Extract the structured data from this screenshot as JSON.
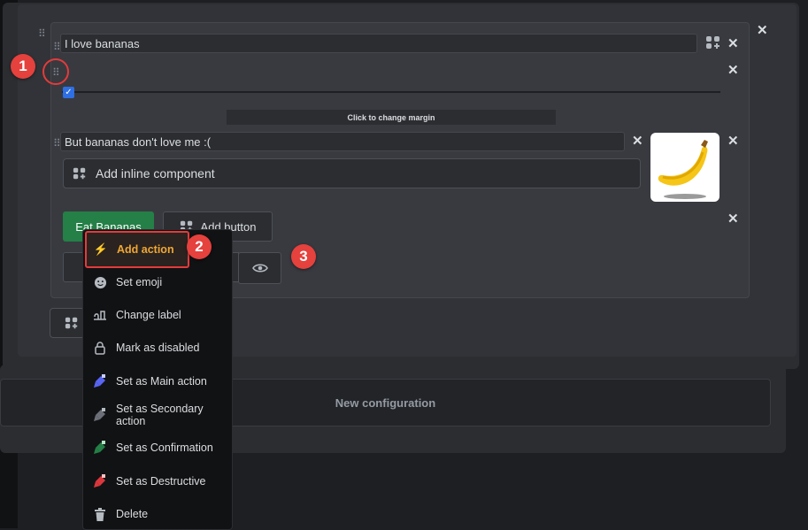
{
  "background": {
    "new_config_label": "New configuration"
  },
  "container": {
    "text1_value": "I love bananas",
    "margin_label": "Click to change margin",
    "text2_value": "But bananas don't love me :(",
    "inline_component_label": "Add inline component",
    "checkbox_checked": true
  },
  "buttons": {
    "primary_label": "Eat Bananas",
    "add_button_label": "Add button"
  },
  "menu": {
    "items": [
      {
        "label": "Add action",
        "icon": "lightning-icon",
        "color": "#f0a733"
      },
      {
        "label": "Set emoji",
        "icon": "smile-icon"
      },
      {
        "label": "Change label",
        "icon": "label-icon"
      },
      {
        "label": "Mark as disabled",
        "icon": "lock-icon"
      },
      {
        "label": "Set as Main action",
        "icon": "brush-icon",
        "color": "#5865f2"
      },
      {
        "label": "Set as Secondary action",
        "icon": "brush-icon",
        "color": "#6d6f78"
      },
      {
        "label": "Set as Confirmation",
        "icon": "brush-icon",
        "color": "#248046"
      },
      {
        "label": "Set as Destructive",
        "icon": "brush-icon",
        "color": "#da373c"
      },
      {
        "label": "Delete",
        "icon": "trash-icon"
      }
    ]
  },
  "markers": [
    "1",
    "2",
    "3"
  ],
  "colors": {
    "accent_red": "#e5413d",
    "primary_green": "#248046",
    "highlight_orange": "#f0a733"
  }
}
